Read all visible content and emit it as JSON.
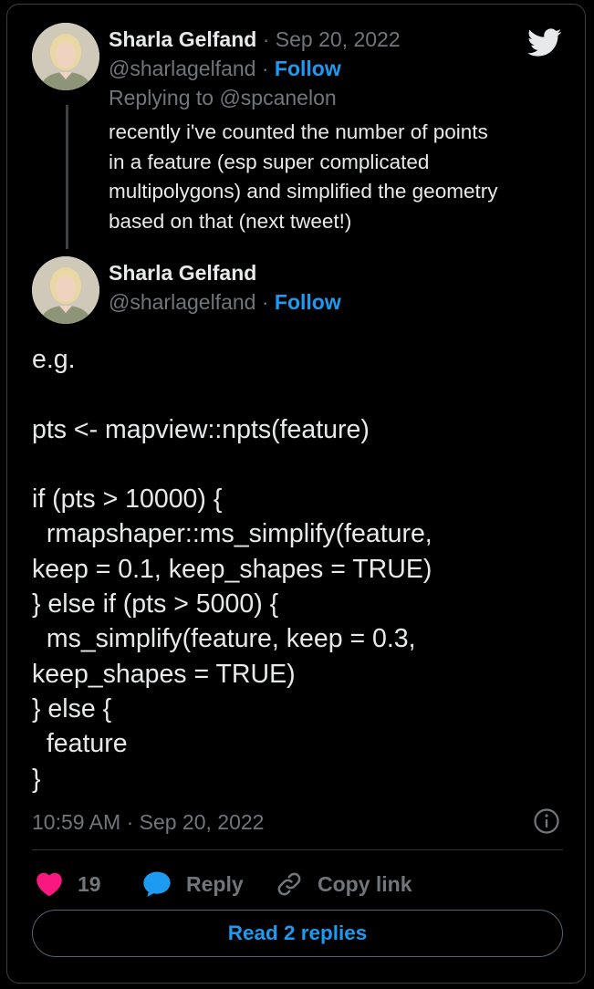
{
  "parent_tweet": {
    "author_name": "Sharla Gelfand",
    "separator": "·",
    "date": "Sep 20, 2022",
    "handle": "@sharlagelfand",
    "follow_label": "Follow",
    "replying_to": "Replying to @spcanelon",
    "text_lines": [
      "recently i've counted the number of points",
      "in a feature (esp super complicated",
      "multipolygons) and simplified the geometry",
      "based on that (next tweet!)"
    ]
  },
  "main_tweet": {
    "author_name": "Sharla Gelfand",
    "handle": "@sharlagelfand",
    "separator": "·",
    "follow_label": "Follow",
    "text_lines": [
      "e.g.",
      "",
      "pts <- mapview::npts(feature)",
      "",
      "if (pts > 10000) {",
      "  rmapshaper::ms_simplify(feature,",
      "keep = 0.1, keep_shapes = TRUE)",
      "} else if (pts > 5000) {",
      "  ms_simplify(feature, keep = 0.3,",
      "keep_shapes = TRUE)",
      "} else {",
      "  feature",
      "}"
    ],
    "timestamp": "10:59 AM · Sep 20, 2022"
  },
  "actions": {
    "like_count": "19",
    "reply_label": "Reply",
    "copy_link_label": "Copy link",
    "read_replies_label": "Read 2 replies"
  },
  "icons": {
    "logo": "twitter-bird-icon",
    "like": "heart-icon",
    "reply": "speech-bubble-icon",
    "copy": "link-icon",
    "info": "info-icon"
  },
  "colors": {
    "background": "#000000",
    "text": "#e7e9ea",
    "muted": "#71767b",
    "accent": "#1d9bf0",
    "like": "#f91880"
  }
}
